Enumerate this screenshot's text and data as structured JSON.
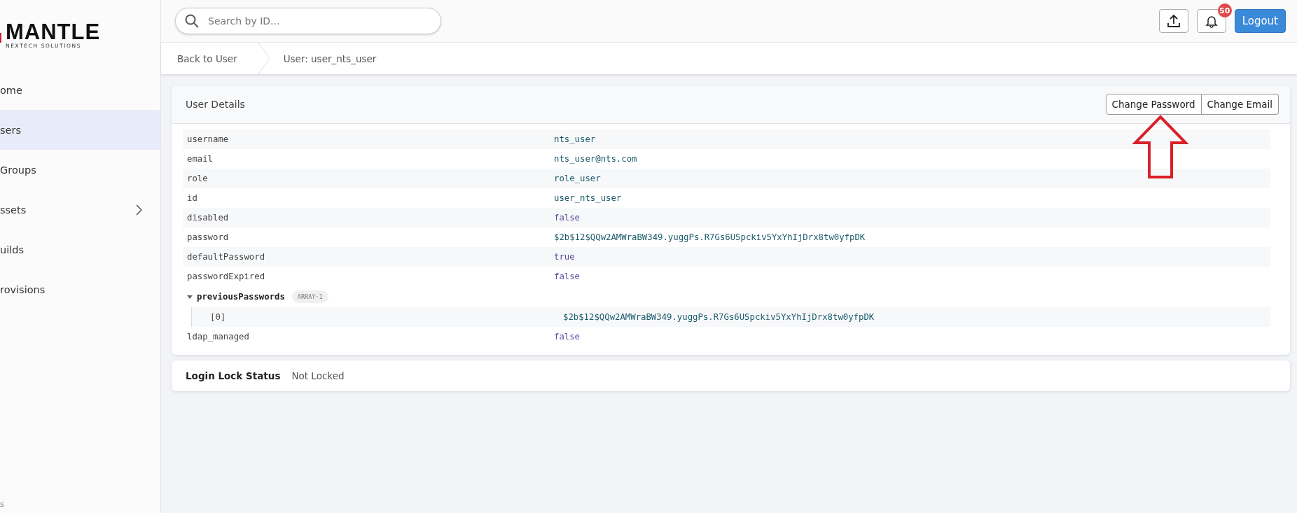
{
  "logo": {
    "name": "MANTLE",
    "tagline": "NEXTECH SOLUTIONS"
  },
  "sidebar": {
    "items": [
      {
        "label": "ome",
        "selected": false,
        "has_children": false
      },
      {
        "label": "sers",
        "selected": true,
        "has_children": false
      },
      {
        "label": "Groups",
        "selected": false,
        "has_children": false
      },
      {
        "label": "ssets",
        "selected": false,
        "has_children": true
      },
      {
        "label": "uilds",
        "selected": false,
        "has_children": false
      },
      {
        "label": "rovisions",
        "selected": false,
        "has_children": false
      }
    ],
    "footer": "s"
  },
  "search": {
    "placeholder": "Search by ID..."
  },
  "header": {
    "notification_count": "50",
    "logout": "Logout"
  },
  "breadcrumb": [
    "Back to User",
    "User: user_nts_user"
  ],
  "user_details": {
    "title": "User Details",
    "actions": [
      "Change Password",
      "Change Email"
    ],
    "rows": [
      {
        "key": "username",
        "value": "nts_user",
        "kind": "string"
      },
      {
        "key": "email",
        "value": "nts_user@nts.com",
        "kind": "string"
      },
      {
        "key": "role",
        "value": "role_user",
        "kind": "string"
      },
      {
        "key": "id",
        "value": "user_nts_user",
        "kind": "string"
      },
      {
        "key": "disabled",
        "value": "false",
        "kind": "boolean"
      },
      {
        "key": "password",
        "value": "$2b$12$QQw2AMWraBW349.yuggPs.R7Gs6USpckiv5YxYhIjDrx8tw0yfpDK",
        "kind": "string"
      },
      {
        "key": "defaultPassword",
        "value": "true",
        "kind": "boolean"
      },
      {
        "key": "passwordExpired",
        "value": "false",
        "kind": "boolean"
      },
      {
        "key": "previousPasswords",
        "kind": "array",
        "badge": "ARRAY·1",
        "expanded": true,
        "children": [
          {
            "key": "[0]",
            "value": "$2b$12$QQw2AMWraBW349.yuggPs.R7Gs6USpckiv5YxYhIjDrx8tw0yfpDK",
            "kind": "string"
          }
        ]
      },
      {
        "key": "ldap_managed",
        "value": "false",
        "kind": "boolean"
      }
    ]
  },
  "login_lock": {
    "label": "Login Lock Status",
    "value": "Not Locked"
  }
}
